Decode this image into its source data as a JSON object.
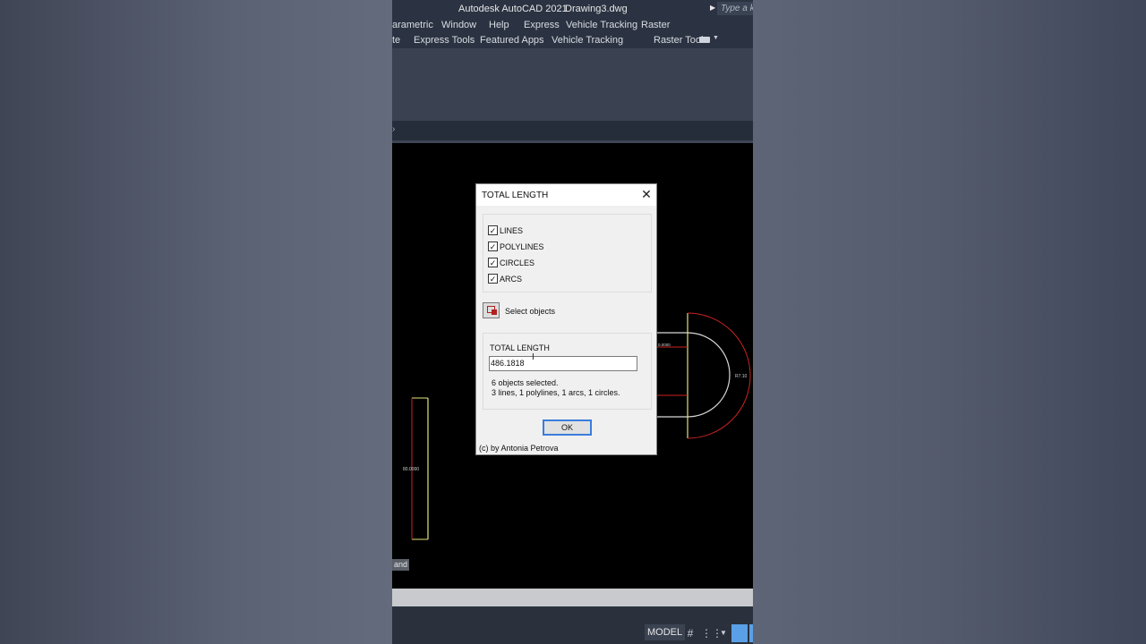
{
  "window": {
    "title": "Autodesk AutoCAD 2021",
    "document": "Drawing3.dwg",
    "search_placeholder": "Type a ke"
  },
  "menubar": {
    "items": [
      "arametric",
      "Window",
      "Help",
      "Express",
      "Vehicle Tracking",
      "Raster"
    ]
  },
  "ribbon_tabs": {
    "items": [
      "te",
      "Express Tools",
      "Featured Apps",
      "Vehicle Tracking",
      "Raster Tools"
    ]
  },
  "canvas": {
    "command_label": "and",
    "dimension_vertical": "80.0000",
    "dimension_arc": "R7.10",
    "dimension_small": "0.0000"
  },
  "statusbar": {
    "model_label": "MODEL"
  },
  "dialog": {
    "title": "TOTAL LENGTH",
    "close_glyph": "✕",
    "checkboxes": [
      {
        "label": "LINES",
        "checked": true
      },
      {
        "label": "POLYLINES",
        "checked": true
      },
      {
        "label": "CIRCLES",
        "checked": true
      },
      {
        "label": "ARCS",
        "checked": true
      }
    ],
    "select_label": "Select objects",
    "total_label": "TOTAL LENGTH",
    "total_value": "486.1818",
    "info_line1": "6 objects selected.",
    "info_line2": "3 lines, 1 polylines, 1 arcs, 1 circles.",
    "ok_label": "OK",
    "credit": "(c) by Antonia Petrova"
  }
}
